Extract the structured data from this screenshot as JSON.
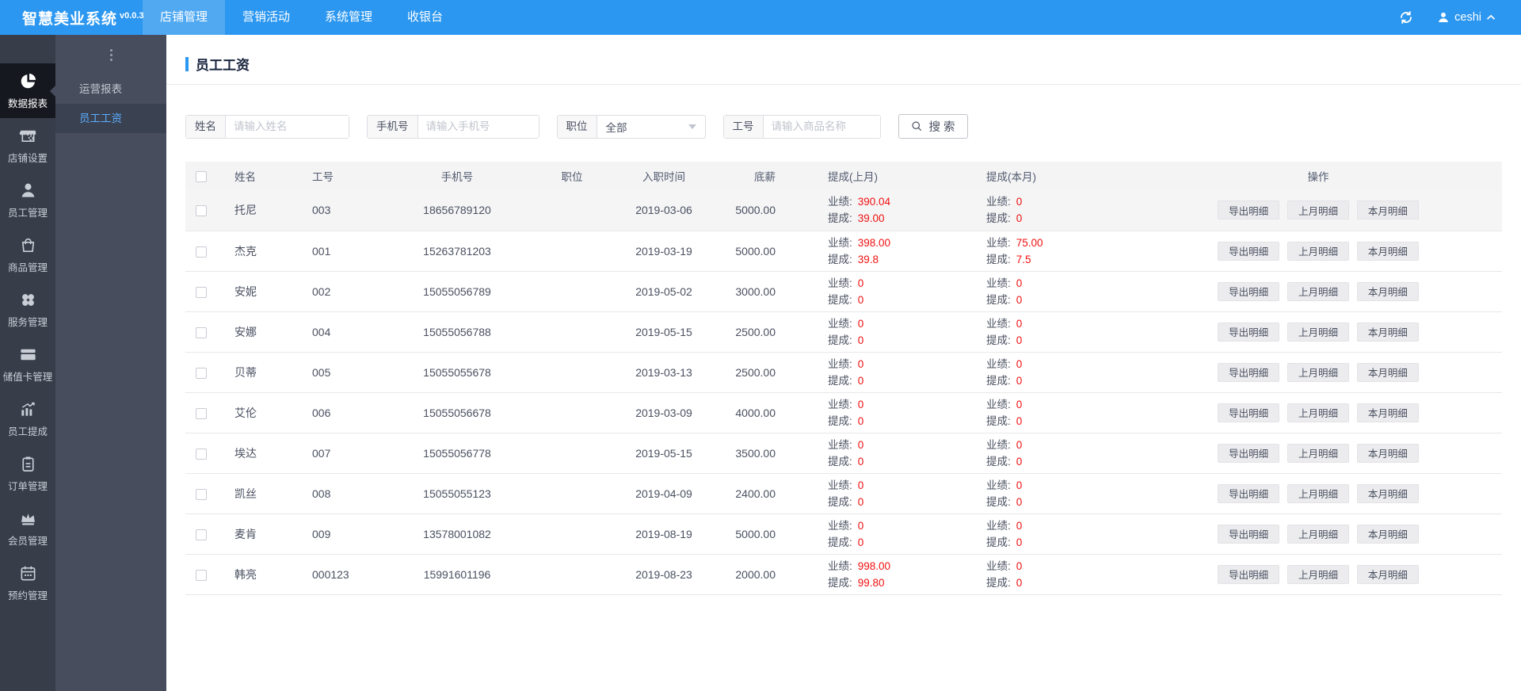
{
  "colors": {
    "accent": "#2b97f0",
    "red": "#f01010"
  },
  "navbar": {
    "logo": "智慧美业系统",
    "version": "v0.0.3",
    "menu": [
      {
        "label": "店铺管理",
        "active": true
      },
      {
        "label": "营销活动",
        "active": false
      },
      {
        "label": "系统管理",
        "active": false
      },
      {
        "label": "收银台",
        "active": false
      }
    ],
    "refresh_icon": "refresh-icon",
    "user_icon": "user-icon",
    "user": "ceshi"
  },
  "sidebar": {
    "items": [
      {
        "label": "数据报表",
        "icon": "pie-chart-icon",
        "active": true
      },
      {
        "label": "店铺设置",
        "icon": "store-icon",
        "active": false
      },
      {
        "label": "员工管理",
        "icon": "staff-icon",
        "active": false
      },
      {
        "label": "商品管理",
        "icon": "goods-bag-icon",
        "active": false
      },
      {
        "label": "服务管理",
        "icon": "service-icon",
        "active": false
      },
      {
        "label": "储值卡管理",
        "icon": "card-icon",
        "active": false
      },
      {
        "label": "员工提成",
        "icon": "commission-chart-icon",
        "active": false
      },
      {
        "label": "订单管理",
        "icon": "order-clipboard-icon",
        "active": false
      },
      {
        "label": "会员管理",
        "icon": "member-crown-icon",
        "active": false
      },
      {
        "label": "预约管理",
        "icon": "appointment-calendar-icon",
        "active": false
      }
    ],
    "submenu": [
      {
        "label": "运营报表",
        "active": false
      },
      {
        "label": "员工工资",
        "active": true
      }
    ]
  },
  "page": {
    "title": "员工工资"
  },
  "filters": {
    "name": {
      "label": "姓名",
      "placeholder": "请输入姓名"
    },
    "phone": {
      "label": "手机号",
      "placeholder": "请输入手机号"
    },
    "position": {
      "label": "职位",
      "value": "全部"
    },
    "staff_id": {
      "label": "工号",
      "placeholder": "请输入商品名称"
    },
    "search_icon": "search-icon",
    "search_label": "搜 索"
  },
  "table": {
    "headers": [
      "姓名",
      "工号",
      "手机号",
      "职位",
      "入职时间",
      "底薪",
      "提成(上月)",
      "提成(本月)",
      "操作"
    ],
    "perf_label": "业绩:",
    "comm_label": "提成:",
    "actions": [
      "导出明细",
      "上月明细",
      "本月明细"
    ],
    "rows": [
      {
        "name": "托尼",
        "id": "003",
        "phone": "18656789120",
        "position": "",
        "date": "2019-03-06",
        "salary": "5000.00",
        "last_perf": "390.04",
        "last_comm": "39.00",
        "this_perf": "0",
        "this_comm": "0",
        "highlighted": true
      },
      {
        "name": "杰克",
        "id": "001",
        "phone": "15263781203",
        "position": "",
        "date": "2019-03-19",
        "salary": "5000.00",
        "last_perf": "398.00",
        "last_comm": "39.8",
        "this_perf": "75.00",
        "this_comm": "7.5",
        "highlighted": false
      },
      {
        "name": "安妮",
        "id": "002",
        "phone": "15055056789",
        "position": "",
        "date": "2019-05-02",
        "salary": "3000.00",
        "last_perf": "0",
        "last_comm": "0",
        "this_perf": "0",
        "this_comm": "0",
        "highlighted": false
      },
      {
        "name": "安娜",
        "id": "004",
        "phone": "15055056788",
        "position": "",
        "date": "2019-05-15",
        "salary": "2500.00",
        "last_perf": "0",
        "last_comm": "0",
        "this_perf": "0",
        "this_comm": "0",
        "highlighted": false
      },
      {
        "name": "贝蒂",
        "id": "005",
        "phone": "15055055678",
        "position": "",
        "date": "2019-03-13",
        "salary": "2500.00",
        "last_perf": "0",
        "last_comm": "0",
        "this_perf": "0",
        "this_comm": "0",
        "highlighted": false
      },
      {
        "name": "艾伦",
        "id": "006",
        "phone": "15055056678",
        "position": "",
        "date": "2019-03-09",
        "salary": "4000.00",
        "last_perf": "0",
        "last_comm": "0",
        "this_perf": "0",
        "this_comm": "0",
        "highlighted": false
      },
      {
        "name": "埃达",
        "id": "007",
        "phone": "15055056778",
        "position": "",
        "date": "2019-05-15",
        "salary": "3500.00",
        "last_perf": "0",
        "last_comm": "0",
        "this_perf": "0",
        "this_comm": "0",
        "highlighted": false
      },
      {
        "name": "凯丝",
        "id": "008",
        "phone": "15055055123",
        "position": "",
        "date": "2019-04-09",
        "salary": "2400.00",
        "last_perf": "0",
        "last_comm": "0",
        "this_perf": "0",
        "this_comm": "0",
        "highlighted": false
      },
      {
        "name": "麦肯",
        "id": "009",
        "phone": "13578001082",
        "position": "",
        "date": "2019-08-19",
        "salary": "5000.00",
        "last_perf": "0",
        "last_comm": "0",
        "this_perf": "0",
        "this_comm": "0",
        "highlighted": false
      },
      {
        "name": "韩亮",
        "id": "000123",
        "phone": "15991601196",
        "position": "",
        "date": "2019-08-23",
        "salary": "2000.00",
        "last_perf": "998.00",
        "last_comm": "99.80",
        "this_perf": "0",
        "this_comm": "0",
        "highlighted": false
      }
    ]
  }
}
